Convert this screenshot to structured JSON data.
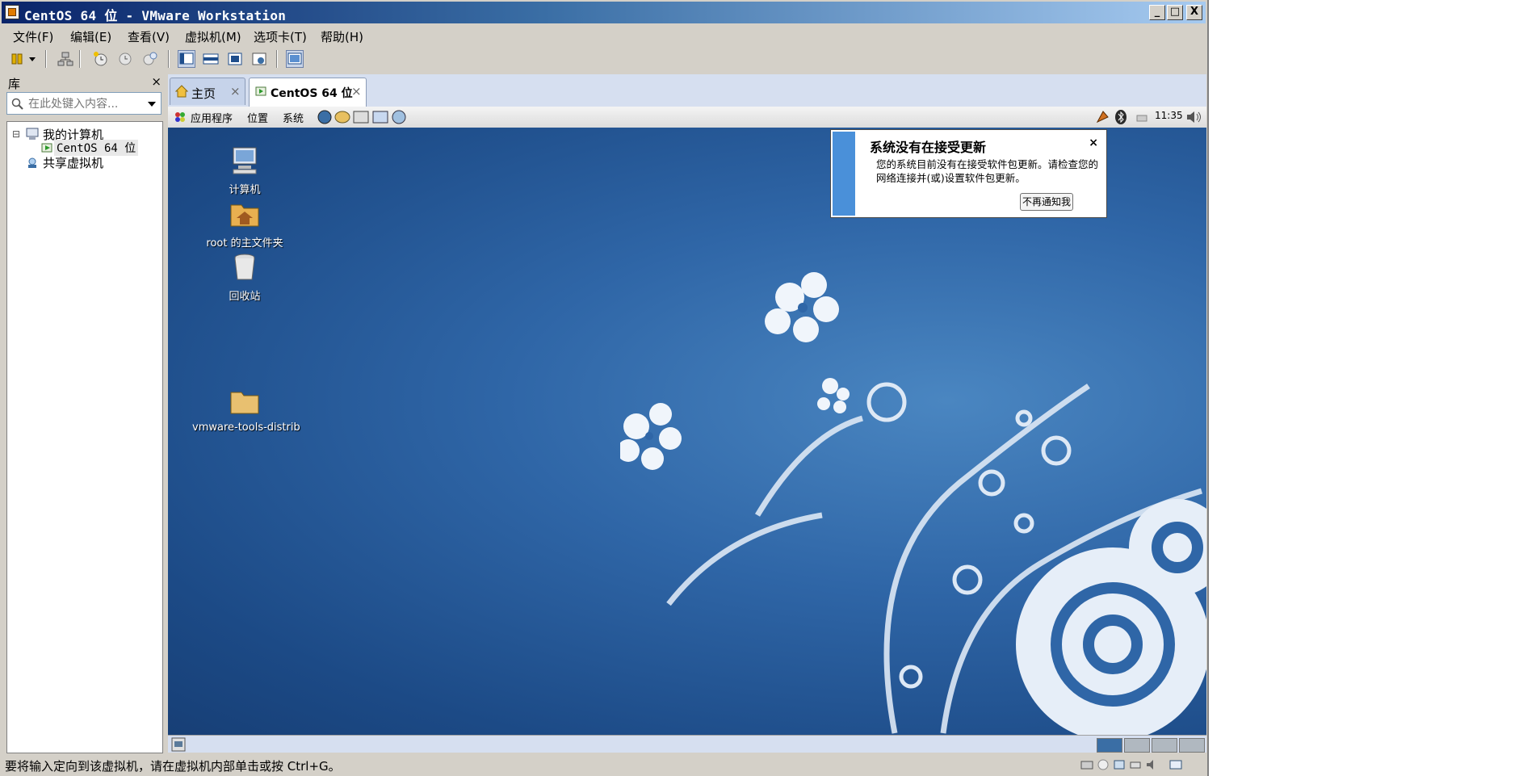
{
  "window": {
    "title": "CentOS 64 位 - VMware Workstation",
    "controls": [
      "_",
      "□",
      "X"
    ]
  },
  "menu": [
    "文件(F)",
    "编辑(E)",
    "查看(V)",
    "虚拟机(M)",
    "选项卡(T)",
    "帮助(H)"
  ],
  "toolbar_icons": [
    "power-icon",
    "dropdown-arrow-icon",
    "network-icon",
    "snapshot-take-icon",
    "snapshot-revert-icon",
    "snapshot-manager-icon",
    "view-console-icon",
    "view-quick-switch-icon",
    "fullscreen-icon",
    "unity-icon",
    "thumbnail-icon"
  ],
  "library": {
    "title": "库",
    "close": "×",
    "search_placeholder": "在此处键入内容...",
    "tree": {
      "collapse": "⊟",
      "my_computer": "我的计算机",
      "vm_item": "CentOS 64 位",
      "shared": "共享虚拟机"
    }
  },
  "tabs": [
    {
      "label": "主页",
      "close": "×",
      "active": false
    },
    {
      "label": "CentOS 64 位",
      "close": "×",
      "active": true
    }
  ],
  "gnome_panel": {
    "menus": [
      "应用程序",
      "位置",
      "系统"
    ],
    "clock": "11:35"
  },
  "desktop_icons": [
    {
      "label": "计算机"
    },
    {
      "label": "root 的主文件夹"
    },
    {
      "label": "回收站"
    },
    {
      "label": "vmware-tools-distrib"
    }
  ],
  "notification": {
    "title": "系统没有在接受更新",
    "close": "×",
    "body": "您的系统目前没有在接受软件包更新。请检查您的网络连接并(或)设置软件包更新。",
    "button": "不再通知我"
  },
  "status": {
    "text": "要将输入定向到该虚拟机，请在虚拟机内部单击或按 Ctrl+G。"
  },
  "colors": {
    "title_gradient_start": "#0a246a",
    "title_gradient_end": "#a6caf0",
    "desktop_blue": "#2f66a7",
    "notif_accent": "#4a90d9"
  }
}
